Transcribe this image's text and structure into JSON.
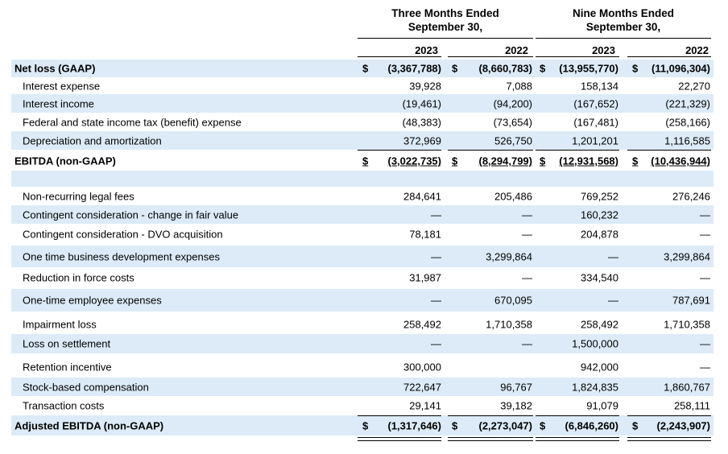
{
  "header": {
    "three_months_line1": "Three Months Ended",
    "three_months_line2": "September 30,",
    "nine_months_line1": "Nine Months Ended",
    "nine_months_line2": "September 30,"
  },
  "years": [
    "2023",
    "2022",
    "2023",
    "2022"
  ],
  "currency_symbol": "$",
  "rows": [
    {
      "label": "Net loss (GAAP)",
      "values": [
        "(3,367,788)",
        "(8,660,783)",
        "(13,955,770)",
        "(11,096,304)"
      ]
    },
    {
      "label": "Interest expense",
      "values": [
        "39,928",
        "7,088",
        "158,134",
        "22,270"
      ]
    },
    {
      "label": "Interest income",
      "values": [
        "(19,461)",
        "(94,200)",
        "(167,652)",
        "(221,329)"
      ]
    },
    {
      "label": "Federal and state income tax (benefit) expense",
      "values": [
        "(48,383)",
        "(73,654)",
        "(167,481)",
        "(258,166)"
      ]
    },
    {
      "label": "Depreciation and amortization",
      "values": [
        "372,969",
        "526,750",
        "1,201,201",
        "1,116,585"
      ]
    },
    {
      "label": "EBITDA (non-GAAP)",
      "values": [
        "(3,022,735)",
        "(8,294,799)",
        "(12,931,568)",
        "(10,436,944)"
      ]
    },
    {
      "label": "",
      "values": [
        "",
        "",
        "",
        ""
      ]
    },
    {
      "label": "Non-recurring legal fees",
      "values": [
        "284,641",
        "205,486",
        "769,252",
        "276,246"
      ]
    },
    {
      "label": "Contingent consideration - change in fair value",
      "values": [
        "—",
        "—",
        "160,232",
        "—"
      ]
    },
    {
      "label": "Contingent consideration - DVO acquisition",
      "values": [
        "78,181",
        "—",
        "204,878",
        "—"
      ]
    },
    {
      "label": "One time business development expenses",
      "values": [
        "—",
        "3,299,864",
        "—",
        "3,299,864"
      ]
    },
    {
      "label": "Reduction in force costs",
      "values": [
        "31,987",
        "—",
        "334,540",
        "—"
      ]
    },
    {
      "label": "One-time employee expenses",
      "values": [
        "—",
        "670,095",
        "—",
        "787,691"
      ]
    },
    {
      "label": "Impairment loss",
      "values": [
        "258,492",
        "1,710,358",
        "258,492",
        "1,710,358"
      ]
    },
    {
      "label": "Loss on settlement",
      "values": [
        "—",
        "—",
        "1,500,000",
        "—"
      ]
    },
    {
      "label": "Retention incentive",
      "values": [
        "300,000",
        "",
        "942,000",
        "—"
      ]
    },
    {
      "label": "Stock-based compensation",
      "values": [
        "722,647",
        "96,767",
        "1,824,835",
        "1,860,767"
      ]
    },
    {
      "label": "Transaction costs",
      "values": [
        "29,141",
        "39,182",
        "91,079",
        "258,111"
      ]
    },
    {
      "label": "Adjusted EBITDA (non-GAAP)",
      "values": [
        "(1,317,646)",
        "(2,273,047)",
        "(6,846,260)",
        "(2,243,907)"
      ]
    }
  ],
  "colors": {
    "row_shade": "#dcebf7",
    "text": "#000000"
  }
}
